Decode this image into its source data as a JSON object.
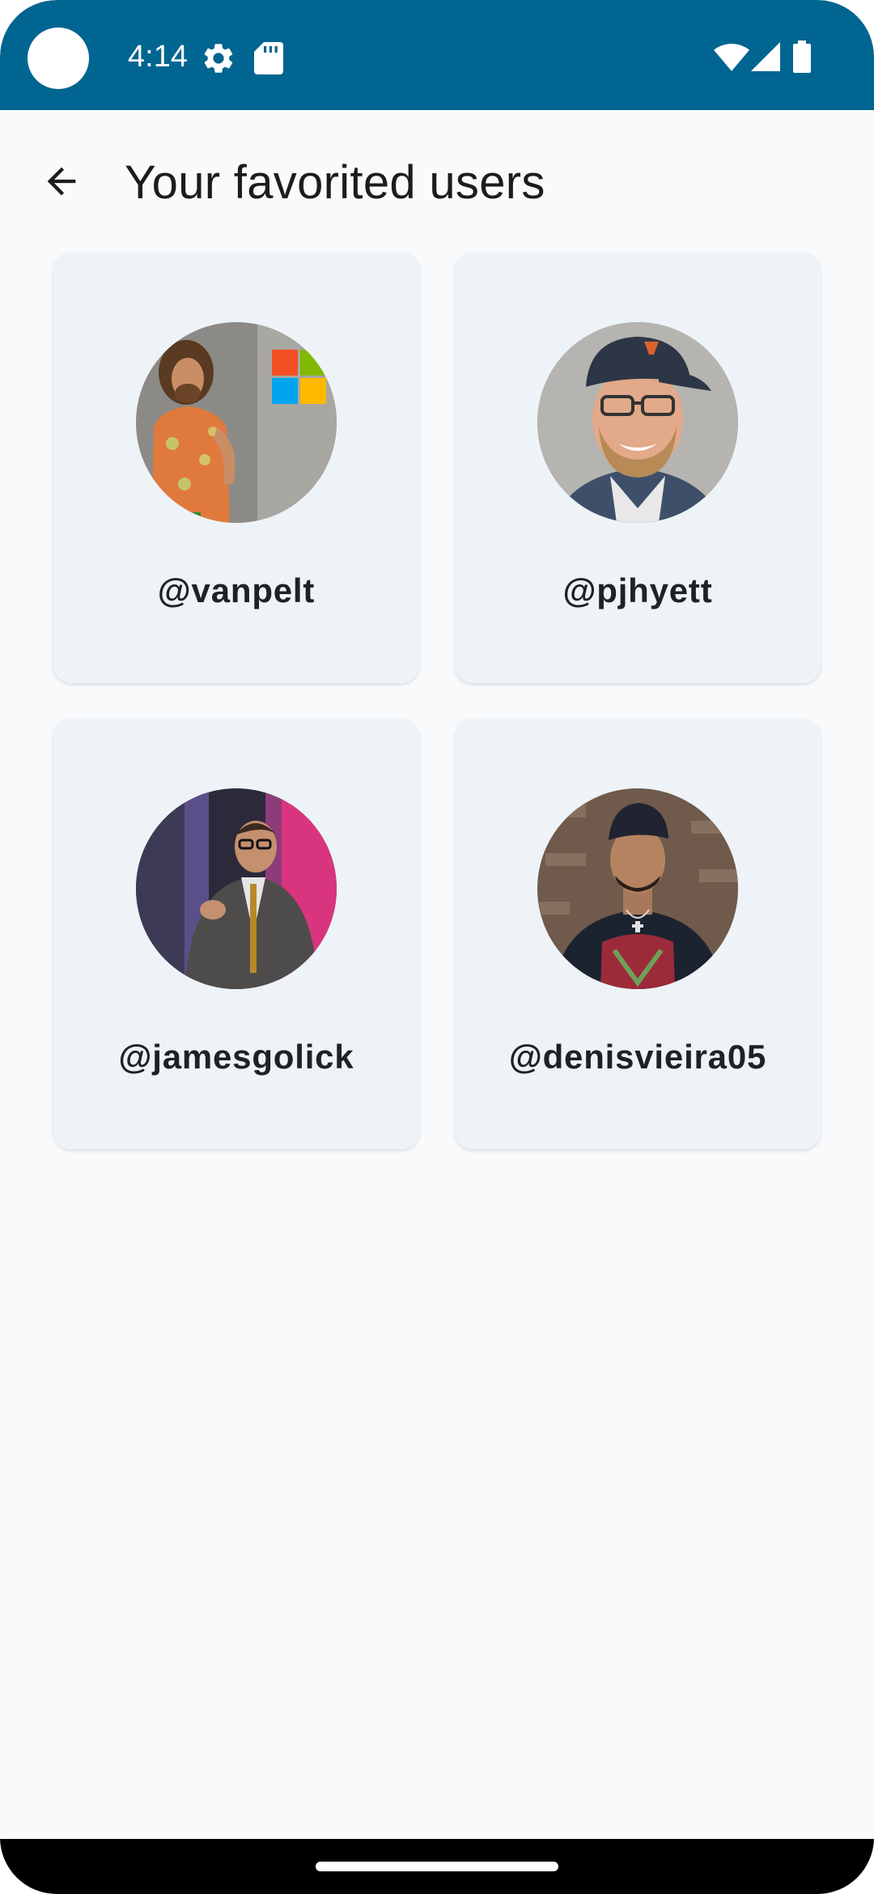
{
  "status_bar": {
    "time": "4:14",
    "background_color": "#006590",
    "icons_left": [
      "settings-gear-icon",
      "sd-card-icon"
    ],
    "icons_right": [
      "wifi-icon",
      "signal-icon",
      "battery-icon"
    ]
  },
  "app_bar": {
    "back_icon": "arrow-left-icon",
    "title": "Your favorited users"
  },
  "favorites": [
    {
      "username": "@vanpelt"
    },
    {
      "username": "@pjhyett"
    },
    {
      "username": "@jamesgolick"
    },
    {
      "username": "@denisvieira05"
    }
  ],
  "colors": {
    "card_background": "#eef3f7",
    "page_background": "#f9fafc",
    "text_primary": "#1b1c1e"
  }
}
